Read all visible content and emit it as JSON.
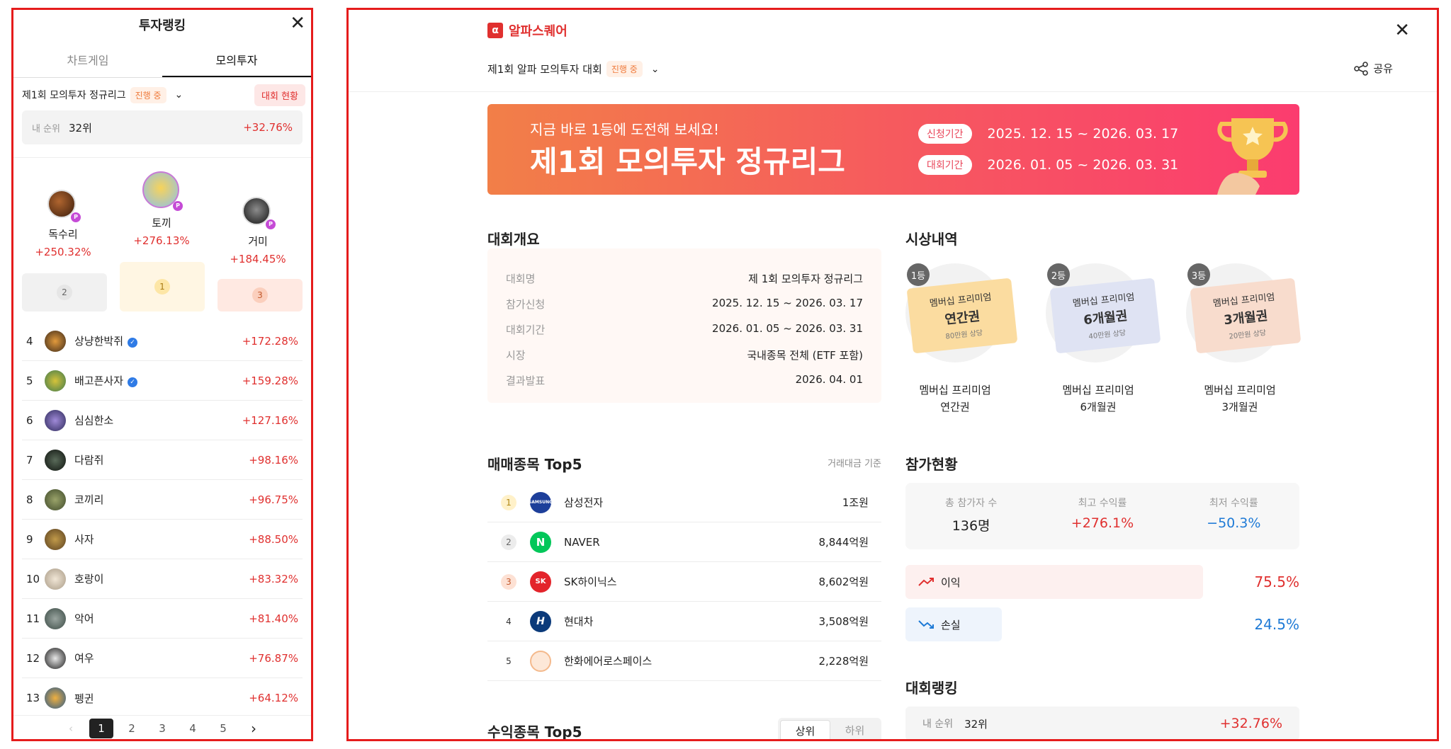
{
  "left": {
    "title": "투자랭킹",
    "tabs": [
      "차트게임",
      "모의투자"
    ],
    "league": {
      "name": "제1회 모의투자 정규리그",
      "status": "진행 중",
      "status_button": "대회 현황"
    },
    "my_rank": {
      "label": "내 순위",
      "rank": "32위",
      "return": "+32.76%"
    },
    "podium": [
      {
        "place": "2",
        "name": "독수리",
        "return": "+250.32%"
      },
      {
        "place": "1",
        "name": "토끼",
        "return": "+276.13%"
      },
      {
        "place": "3",
        "name": "거미",
        "return": "+184.45%"
      }
    ],
    "rows": [
      {
        "rank": "4",
        "name": "상냥한박쥐",
        "verified": true,
        "return": "+172.28%"
      },
      {
        "rank": "5",
        "name": "배고픈사자",
        "verified": true,
        "return": "+159.28%"
      },
      {
        "rank": "6",
        "name": "심심한소",
        "verified": false,
        "return": "+127.16%"
      },
      {
        "rank": "7",
        "name": "다람쥐",
        "verified": false,
        "return": "+98.16%"
      },
      {
        "rank": "8",
        "name": "코끼리",
        "verified": false,
        "return": "+96.75%"
      },
      {
        "rank": "9",
        "name": "사자",
        "verified": false,
        "return": "+88.50%"
      },
      {
        "rank": "10",
        "name": "호랑이",
        "verified": false,
        "return": "+83.32%"
      },
      {
        "rank": "11",
        "name": "악어",
        "verified": false,
        "return": "+81.40%"
      },
      {
        "rank": "12",
        "name": "여우",
        "verified": false,
        "return": "+76.87%"
      },
      {
        "rank": "13",
        "name": "펭귄",
        "verified": false,
        "return": "+64.12%"
      }
    ],
    "pager": {
      "pages": [
        "1",
        "2",
        "3",
        "4",
        "5"
      ],
      "current": "1",
      "prev": "‹",
      "next": "›"
    }
  },
  "right": {
    "brand": "알파스퀘어",
    "brand_mark": "α",
    "contest_name": "제1회 알파 모의투자 대회",
    "contest_status": "진행 중",
    "share_label": "공유",
    "banner": {
      "subtitle": "지금 바로 1등에 도전해 보세요!",
      "title": "제1회 모의투자 정규리그",
      "apply_tag": "신청기간",
      "apply_period": "2025. 12. 15 ~ 2026. 03. 17",
      "contest_tag": "대회기간",
      "contest_period": "2026. 01. 05 ~ 2026. 03. 31"
    },
    "summary": {
      "heading": "대회개요",
      "rows": [
        {
          "k": "대회명",
          "v": "제 1회 모의투자 정규리그"
        },
        {
          "k": "참가신청",
          "v": "2025. 12. 15 ~ 2026. 03. 17"
        },
        {
          "k": "대회기간",
          "v": "2026. 01. 05 ~ 2026. 03. 31"
        },
        {
          "k": "시장",
          "v": "국내종목 전체 (ETF 포함)"
        },
        {
          "k": "결과발표",
          "v": "2026. 04. 01"
        }
      ]
    },
    "prizes": {
      "heading": "시상내역",
      "items": [
        {
          "badge": "1등",
          "t1": "멤버십 프리미엄",
          "t2": "연간권",
          "t3": "80만원 상당",
          "cap1": "멤버십 프리미엄",
          "cap2": "연간권",
          "color": "#fbdca0"
        },
        {
          "badge": "2등",
          "t1": "멤버십 프리미엄",
          "t2": "6개월권",
          "t3": "40만원 상당",
          "cap1": "멤버십 프리미엄",
          "cap2": "6개월권",
          "color": "#dfe3f3"
        },
        {
          "badge": "3등",
          "t1": "멤버십 프리미엄",
          "t2": "3개월권",
          "t3": "20만원 상당",
          "cap1": "멤버십 프리미엄",
          "cap2": "3개월권",
          "color": "#f8dccd"
        }
      ]
    },
    "trade_top5": {
      "heading": "매매종목 Top5",
      "basis": "거래대금 기준",
      "rows": [
        {
          "rank": "1",
          "name": "삼성전자",
          "value": "1조원",
          "logo": "SAMSUNG",
          "logo_color": "#1d3f9a"
        },
        {
          "rank": "2",
          "name": "NAVER",
          "value": "8,844억원",
          "logo": "N",
          "logo_color": "#03c75a"
        },
        {
          "rank": "3",
          "name": "SK하이닉스",
          "value": "8,602억원",
          "logo": "SK",
          "logo_color": "#e3242b"
        },
        {
          "rank": "4",
          "name": "현대차",
          "value": "3,508억원",
          "logo": "H",
          "logo_color": "#0b3a7a"
        },
        {
          "rank": "5",
          "name": "한화에어로스페이스",
          "value": "2,228억원",
          "logo": "",
          "logo_color": "#f8c9a6"
        }
      ]
    },
    "participation": {
      "heading": "참가현황",
      "total_label": "총 참가자 수",
      "total": "136명",
      "max_label": "최고 수익률",
      "max": "+276.1%",
      "min_label": "최저 수익률",
      "min": "−50.3%",
      "profit_label": "이익",
      "profit": "75.5%",
      "profit_ratio": 0.755,
      "loss_label": "손실",
      "loss": "24.5%",
      "loss_ratio": 0.245
    },
    "return_top5": {
      "heading": "수익종목 Top5",
      "upper": "상위",
      "lower": "하위"
    },
    "contest_ranking": {
      "heading": "대회랭킹",
      "my_label": "내 순위",
      "my_rank": "32위",
      "my_return": "+32.76%"
    }
  }
}
